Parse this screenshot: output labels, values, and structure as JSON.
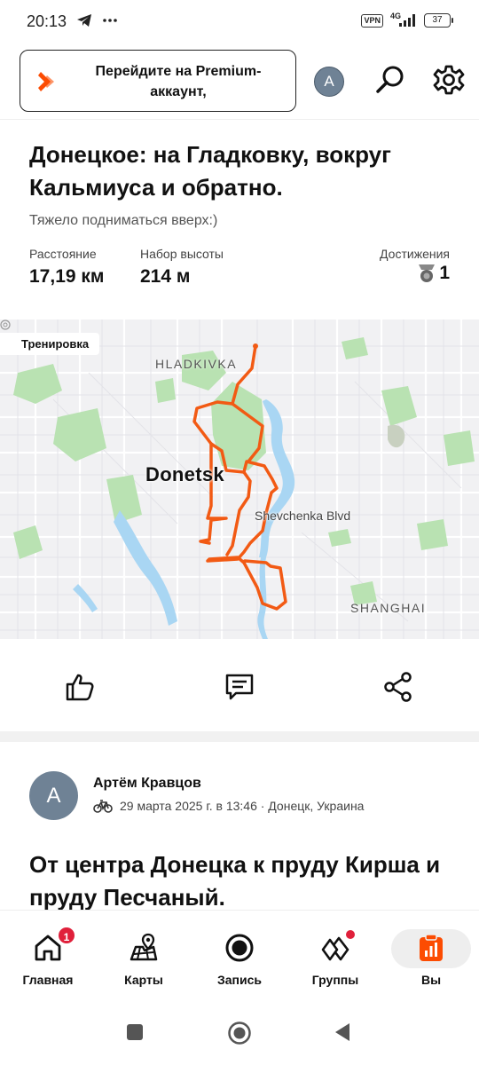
{
  "status_bar": {
    "time": "20:13",
    "vpn": "VPN",
    "network": "4G",
    "battery": "37"
  },
  "header": {
    "premium_text": "Перейдите на Premium-аккаунт,",
    "avatar_initial": "A"
  },
  "activity": {
    "title": "Донецкое: на Гладковку, вокруг Кальмиуса и обратно.",
    "description": "Тяжело подниматься вверх:)",
    "stats": {
      "distance_label": "Расстояние",
      "distance_value": "17,19 км",
      "elevation_label": "Набор высоты",
      "elevation_value": "214 м",
      "achievements_label": "Достижения",
      "achievements_value": "1"
    },
    "map": {
      "badge": "Тренировка",
      "city": "Donetsk",
      "district_north": "HLADKIVKA",
      "district_south": "SHANGHAI",
      "street": "Shevchenka Blvd"
    }
  },
  "next_post": {
    "avatar_initial": "A",
    "author": "Артём Кравцов",
    "meta": "29 марта 2025 г. в 13:46 · Донецк, Украина",
    "title": "От центра Донецка к пруду Кирша и пруду Песчаный."
  },
  "bottom_nav": {
    "items": [
      {
        "label": "Главная",
        "badge": "1"
      },
      {
        "label": "Карты"
      },
      {
        "label": "Запись"
      },
      {
        "label": "Группы"
      },
      {
        "label": "Вы"
      }
    ]
  },
  "colors": {
    "brand": "#fc4c02",
    "route": "#f25a14",
    "water": "#a9d6f3",
    "park": "#b9e2b2",
    "badge": "#e0203b"
  }
}
